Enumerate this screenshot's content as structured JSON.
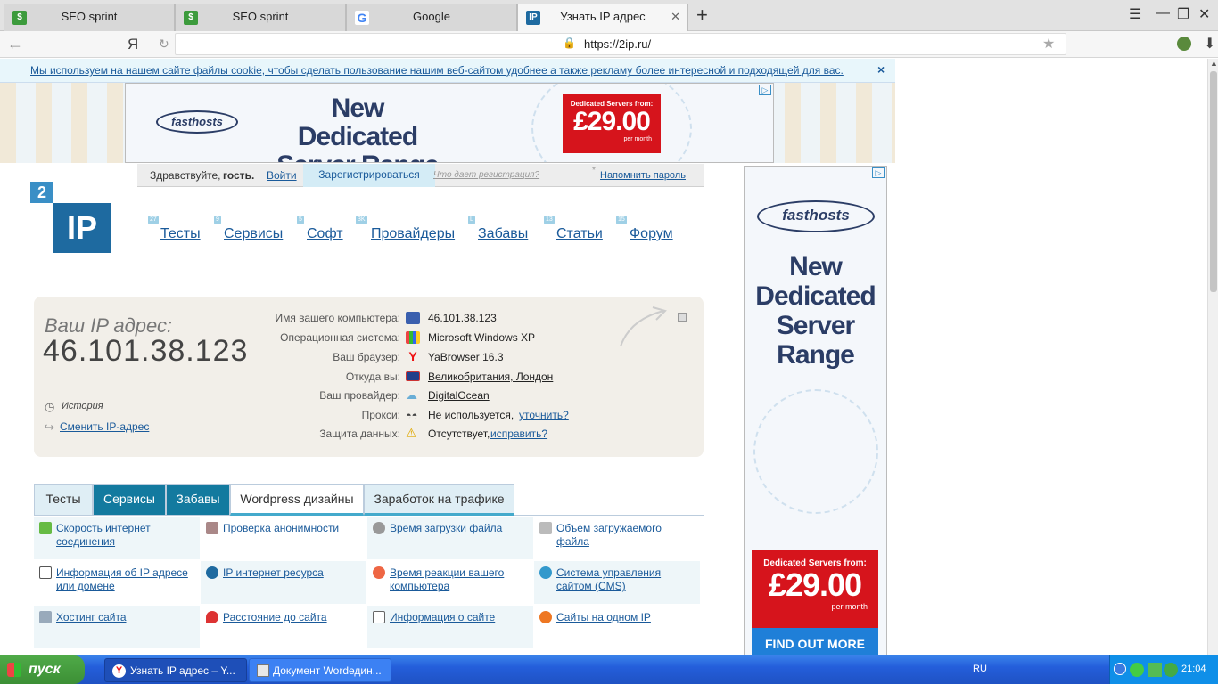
{
  "browser": {
    "tabs": [
      {
        "label": "SEO sprint",
        "icon": "seosprint-icon",
        "active": false
      },
      {
        "label": "SEO sprint",
        "icon": "seosprint-icon",
        "active": false
      },
      {
        "label": "Google",
        "icon": "google-icon",
        "active": false
      },
      {
        "label": "Узнать IP адрес",
        "icon": "2ip-icon",
        "active": true
      }
    ],
    "url": "https://2ip.ru/",
    "yandex_letter": "Я",
    "new_tab": "+"
  },
  "cookie": {
    "text": "Мы используем на нашем сайте файлы cookie, чтобы сделать пользование нашим веб-сайтом удобнее а также рекламу более интересной и подходящей для вас.",
    "close": "×"
  },
  "top_ad": {
    "brand": "fasthosts",
    "headline_1": "New Dedicated",
    "headline_2": "Server Range",
    "from": "Dedicated Servers from:",
    "price": "£29.00",
    "per": "per month"
  },
  "right_ad": {
    "brand": "fasthosts",
    "headline": [
      "New",
      "Dedicated",
      "Server",
      "Range"
    ],
    "from": "Dedicated Servers from:",
    "price": "£29.00",
    "per": "per month",
    "cta": "FIND OUT MORE"
  },
  "login": {
    "greeting": "Здравствуйте,",
    "guest": "гость.",
    "login": "Войти",
    "register": "Зарегистрироваться",
    "what": "Что дает регистрация?",
    "star": "*",
    "remind": "Напомнить пароль"
  },
  "logo": {
    "num": "2",
    "text": "IP"
  },
  "nav": [
    {
      "label": "Тесты",
      "badge": "27"
    },
    {
      "label": "Сервисы",
      "badge": "9"
    },
    {
      "label": "Софт",
      "badge": "5"
    },
    {
      "label": "Провайдеры",
      "badge": "3K"
    },
    {
      "label": "Забавы",
      "badge": "L"
    },
    {
      "label": "Статьи",
      "badge": "13"
    },
    {
      "label": "Форум",
      "badge": "15"
    }
  ],
  "ip": {
    "caption": "Ваш IP адрес:",
    "address": "46.101.38.123",
    "history": "История",
    "change": "Сменить IP-адрес",
    "rows": [
      {
        "label": "Имя вашего компьютера:",
        "value": "46.101.38.123",
        "link": ""
      },
      {
        "label": "Операционная система:",
        "value": "Microsoft Windows XP",
        "link": ""
      },
      {
        "label": "Ваш браузер:",
        "value": "YaBrowser 16.3",
        "link": ""
      },
      {
        "label": "Откуда вы:",
        "value": "",
        "link": "Великобритания, Лондон"
      },
      {
        "label": "Ваш провайдер:",
        "value": "",
        "link": "DigitalOcean"
      },
      {
        "label": "Прокси:",
        "value": "Не используется,",
        "link": "уточнить?"
      },
      {
        "label": "Защита данных:",
        "value": "Отсутствует,",
        "link": "исправить?"
      }
    ]
  },
  "content_tabs": [
    {
      "label": "Тесты"
    },
    {
      "label": "Сервисы"
    },
    {
      "label": "Забавы"
    },
    {
      "label": "Wordpress дизайны"
    },
    {
      "label": "Заработок на трафике"
    }
  ],
  "services": [
    [
      "Скорость интернет соединения",
      "Проверка анонимности",
      "Время загрузки файла",
      "Объем загружаемого файла"
    ],
    [
      "Информация об IP адресе или домене",
      "IP интернет ресурса",
      "Время реакции вашего компьютера",
      "Система управления сайтом (CMS)"
    ],
    [
      "Хостинг сайта",
      "Расстояние до сайта",
      "Информация о сайте",
      "Сайты на одном IP"
    ]
  ],
  "taskbar": {
    "start": "пуск",
    "tasks": [
      "Узнать IP адрес – Y...",
      "Документ Wordедин..."
    ],
    "lang": "RU",
    "clock": "21:04"
  },
  "colors": {
    "accent": "#1e6aa0",
    "tab_active": "#137a9f",
    "taskbar": "#245edb",
    "start": "#3c8f35"
  }
}
